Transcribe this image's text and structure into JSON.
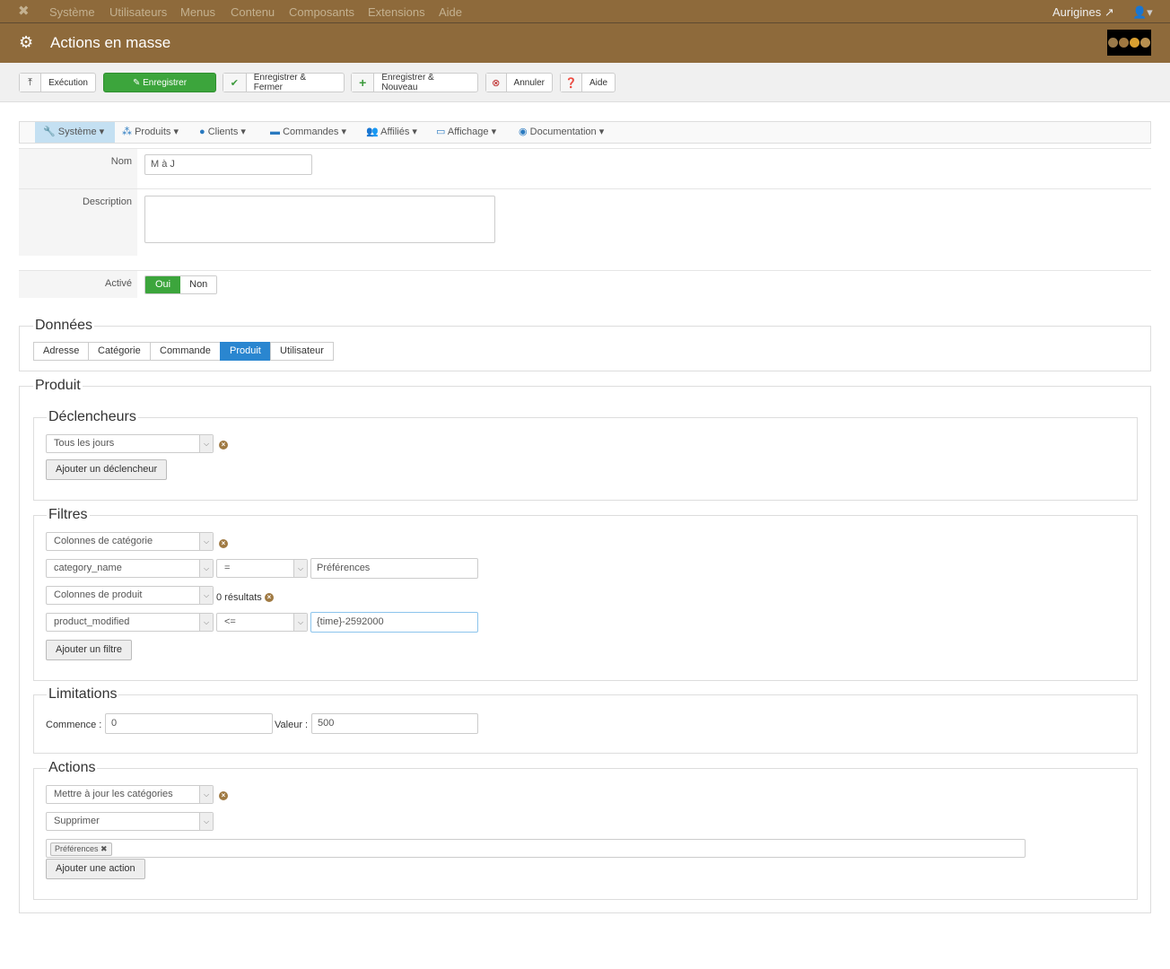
{
  "topnav": {
    "items": [
      "Système",
      "Utilisateurs",
      "Menus",
      "Contenu",
      "Composants",
      "Extensions",
      "Aide"
    ],
    "site": "Aurigines"
  },
  "header": {
    "title": "Actions en masse"
  },
  "toolbar": {
    "execution": "Exécution",
    "save": "Enregistrer",
    "save_close": "Enregistrer & Fermer",
    "save_new": "Enregistrer & Nouveau",
    "cancel": "Annuler",
    "help": "Aide"
  },
  "submenu": [
    "Système",
    "Produits",
    "Clients",
    "Commandes",
    "Affiliés",
    "Affichage",
    "Documentation"
  ],
  "form": {
    "name_label": "Nom",
    "name_value": "M à J",
    "desc_label": "Description",
    "desc_value": "",
    "active_label": "Activé",
    "yes": "Oui",
    "no": "Non"
  },
  "data": {
    "legend": "Données",
    "tabs": [
      "Adresse",
      "Catégorie",
      "Commande",
      "Produit",
      "Utilisateur"
    ],
    "active_tab": "Produit"
  },
  "product": {
    "legend": "Produit",
    "triggers": {
      "legend": "Déclencheurs",
      "select": "Tous les jours",
      "add": "Ajouter un déclencheur"
    },
    "filters": {
      "legend": "Filtres",
      "f1_type": "Colonnes de catégorie",
      "f1_col": "category_name",
      "f1_op": "=",
      "f1_val": "Préférences",
      "f2_type": "Colonnes de produit",
      "f2_results": "0 résultats",
      "f2_col": "product_modified",
      "f2_op": "<=",
      "f2_val": "{time}-2592000",
      "add": "Ajouter un filtre"
    },
    "limits": {
      "legend": "Limitations",
      "start_label": "Commence :",
      "start_value": "0",
      "value_label": "Valeur :",
      "value_value": "500"
    },
    "actions": {
      "legend": "Actions",
      "a1": "Mettre à jour les catégories",
      "a2": "Supprimer",
      "tag": "Préférences",
      "add": "Ajouter une action"
    }
  }
}
